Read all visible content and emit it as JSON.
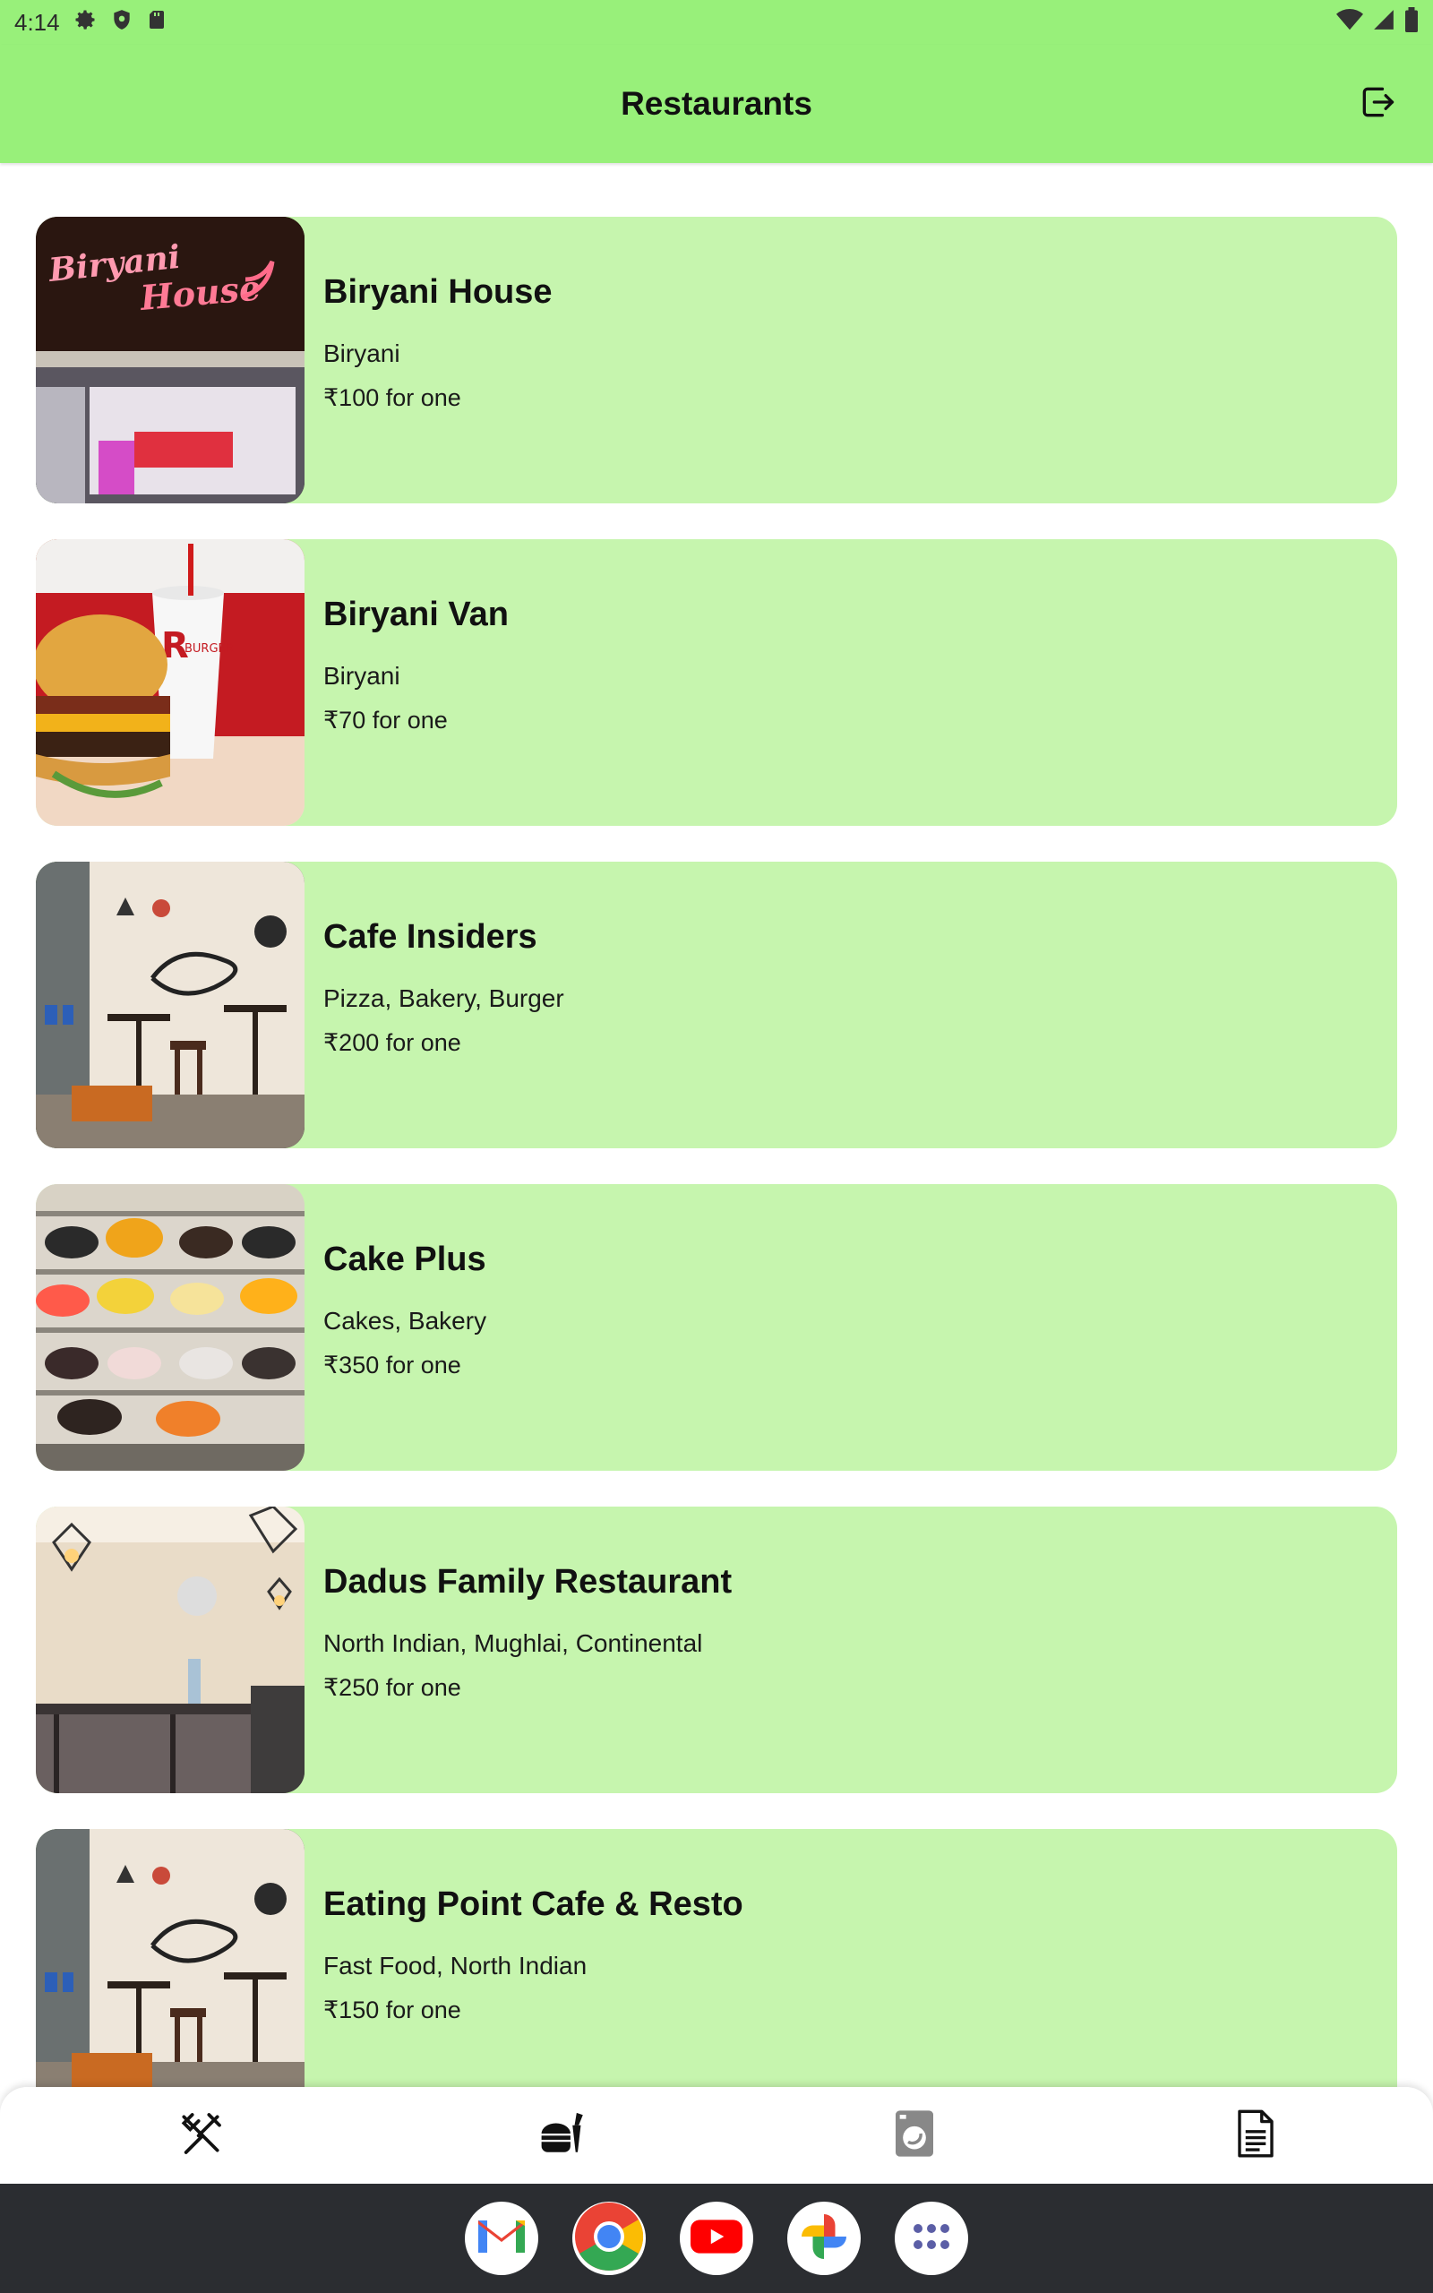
{
  "status_bar": {
    "time": "4:14"
  },
  "app_bar": {
    "title": "Restaurants"
  },
  "restaurants": [
    {
      "name": "Biryani House",
      "cuisine": "Biryani",
      "price": "₹100 for one"
    },
    {
      "name": "Biryani Van",
      "cuisine": "Biryani",
      "price": "₹70 for one"
    },
    {
      "name": "Cafe Insiders",
      "cuisine": "Pizza, Bakery, Burger",
      "price": "₹200 for one"
    },
    {
      "name": "Cake Plus",
      "cuisine": "Cakes, Bakery",
      "price": "₹350 for one"
    },
    {
      "name": "Dadus Family Restaurant",
      "cuisine": "North Indian, Mughlai, Continental",
      "price": "₹250 for one"
    },
    {
      "name": "Eating Point Cafe & Resto",
      "cuisine": "Fast Food, North Indian",
      "price": "₹150 for one"
    }
  ],
  "thumb_signs": {
    "biryani_house_line1": "Biryani",
    "biryani_house_line2": "House",
    "biryani_van_cup": "BURGER"
  },
  "bottom_nav": [
    {
      "icon": "fork-knife-icon"
    },
    {
      "icon": "food-delivery-icon"
    },
    {
      "icon": "washing-machine-icon"
    },
    {
      "icon": "document-icon"
    }
  ],
  "dock": [
    "gmail-icon",
    "chrome-icon",
    "youtube-icon",
    "photos-icon",
    "apps-icon"
  ],
  "colors": {
    "accent": "#98f07a",
    "card": "#c6f5ae",
    "dock": "#2b2d31"
  }
}
